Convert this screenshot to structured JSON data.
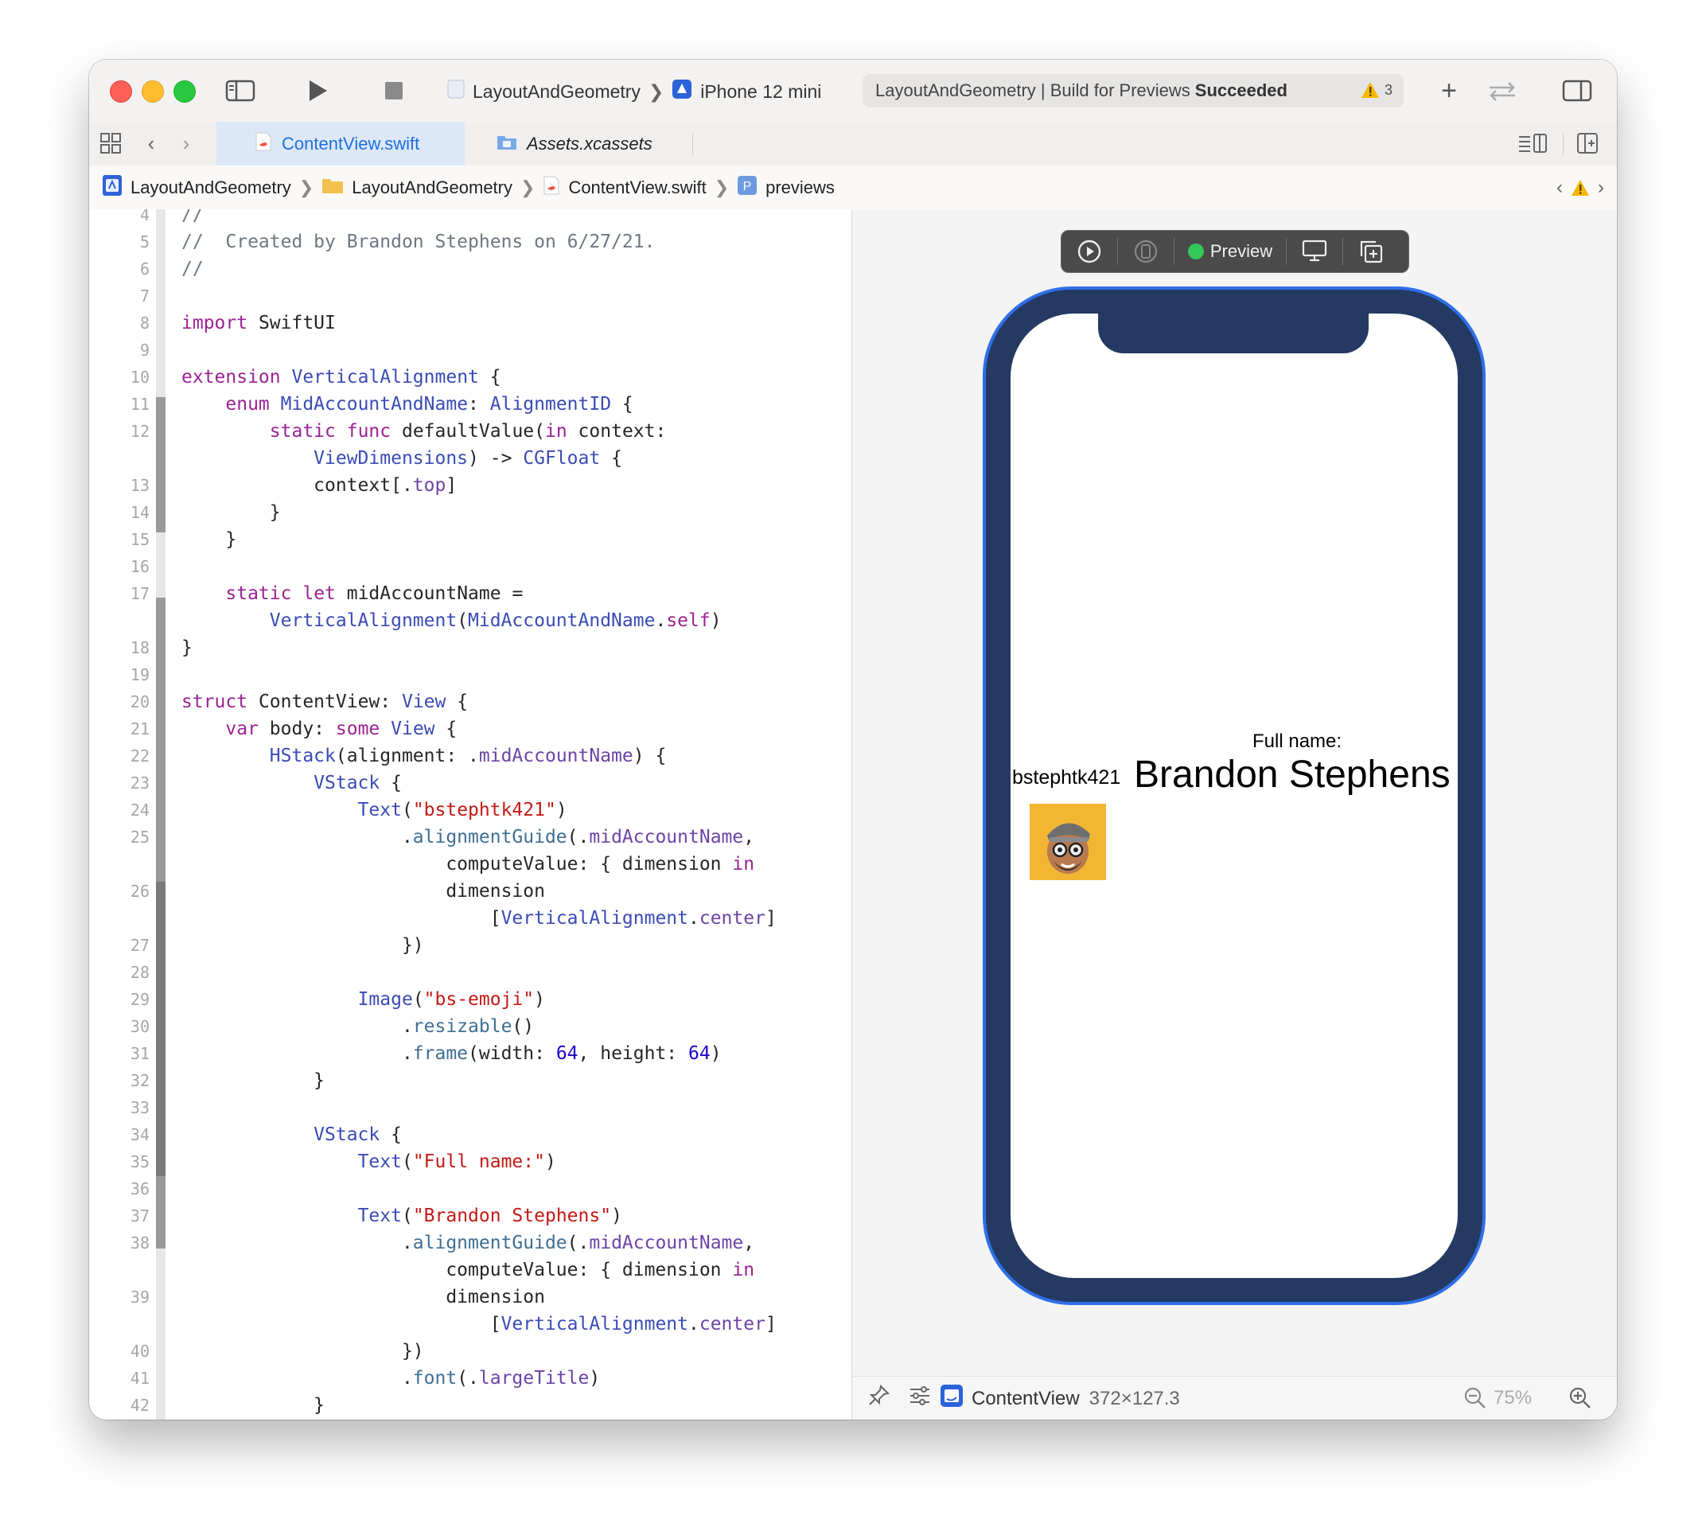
{
  "toolbar": {
    "scheme_project": "LayoutAndGeometry",
    "scheme_device": "iPhone 12 mini",
    "status_prefix": "LayoutAndGeometry | Build for Previews",
    "status_result": "Succeeded",
    "warning_count": "3"
  },
  "tabs": [
    {
      "label": "ContentView.swift",
      "active": true
    },
    {
      "label": "Assets.xcassets",
      "active": false
    }
  ],
  "breadcrumb": [
    "LayoutAndGeometry",
    "LayoutAndGeometry",
    "ContentView.swift",
    "previews"
  ],
  "editor": {
    "lines": [
      {
        "n": "4",
        "code": "//"
      },
      {
        "n": "5",
        "code": "//  Created by Brandon Stephens on 6/27/21."
      },
      {
        "n": "6",
        "code": "//"
      },
      {
        "n": "7",
        "code": ""
      },
      {
        "n": "8",
        "code": "import SwiftUI"
      },
      {
        "n": "9",
        "code": ""
      },
      {
        "n": "10",
        "code": "extension VerticalAlignment {"
      },
      {
        "n": "11",
        "code": "    enum MidAccountAndName: AlignmentID {"
      },
      {
        "n": "12",
        "code": "        static func defaultValue(in context:"
      },
      {
        "n": "",
        "code": "            ViewDimensions) -> CGFloat {"
      },
      {
        "n": "13",
        "code": "            context[.top]"
      },
      {
        "n": "14",
        "code": "        }"
      },
      {
        "n": "15",
        "code": "    }"
      },
      {
        "n": "16",
        "code": ""
      },
      {
        "n": "17",
        "code": "    static let midAccountName ="
      },
      {
        "n": "",
        "code": "        VerticalAlignment(MidAccountAndName.self)"
      },
      {
        "n": "18",
        "code": "}"
      },
      {
        "n": "19",
        "code": ""
      },
      {
        "n": "20",
        "code": "struct ContentView: View {"
      },
      {
        "n": "21",
        "code": "    var body: some View {"
      },
      {
        "n": "22",
        "code": "        HStack(alignment: .midAccountName) {"
      },
      {
        "n": "23",
        "code": "            VStack {"
      },
      {
        "n": "24",
        "code": "                Text(\"bstephtk421\")"
      },
      {
        "n": "25",
        "code": "                    .alignmentGuide(.midAccountName,"
      },
      {
        "n": "",
        "code": "                        computeValue: { dimension in"
      },
      {
        "n": "26",
        "code": "                        dimension"
      },
      {
        "n": "",
        "code": "                            [VerticalAlignment.center]"
      },
      {
        "n": "27",
        "code": "                    })"
      },
      {
        "n": "28",
        "code": ""
      },
      {
        "n": "29",
        "code": "                Image(\"bs-emoji\")"
      },
      {
        "n": "30",
        "code": "                    .resizable()"
      },
      {
        "n": "31",
        "code": "                    .frame(width: 64, height: 64)"
      },
      {
        "n": "32",
        "code": "            }"
      },
      {
        "n": "33",
        "code": ""
      },
      {
        "n": "34",
        "code": "            VStack {"
      },
      {
        "n": "35",
        "code": "                Text(\"Full name:\")"
      },
      {
        "n": "36",
        "code": ""
      },
      {
        "n": "37",
        "code": "                Text(\"Brandon Stephens\")"
      },
      {
        "n": "38",
        "code": "                    .alignmentGuide(.midAccountName,"
      },
      {
        "n": "",
        "code": "                        computeValue: { dimension in"
      },
      {
        "n": "39",
        "code": "                        dimension"
      },
      {
        "n": "",
        "code": "                            [VerticalAlignment.center]"
      },
      {
        "n": "40",
        "code": "                    })"
      },
      {
        "n": "41",
        "code": "                    .font(.largeTitle)"
      },
      {
        "n": "42",
        "code": "            }"
      }
    ]
  },
  "preview": {
    "toolbar_label": "Preview",
    "username": "bstephtk421",
    "fullname_label": "Full name:",
    "fullname": "Brandon Stephens"
  },
  "footer": {
    "view_name": "ContentView",
    "view_size": "372×127.3",
    "zoom": "75%"
  },
  "colors": {
    "accent": "#1f6fe0",
    "phone_body": "#243a63",
    "phone_edge": "#2f6fe8",
    "avatar_bg": "#f2b632",
    "preview_status": "#34c759"
  }
}
